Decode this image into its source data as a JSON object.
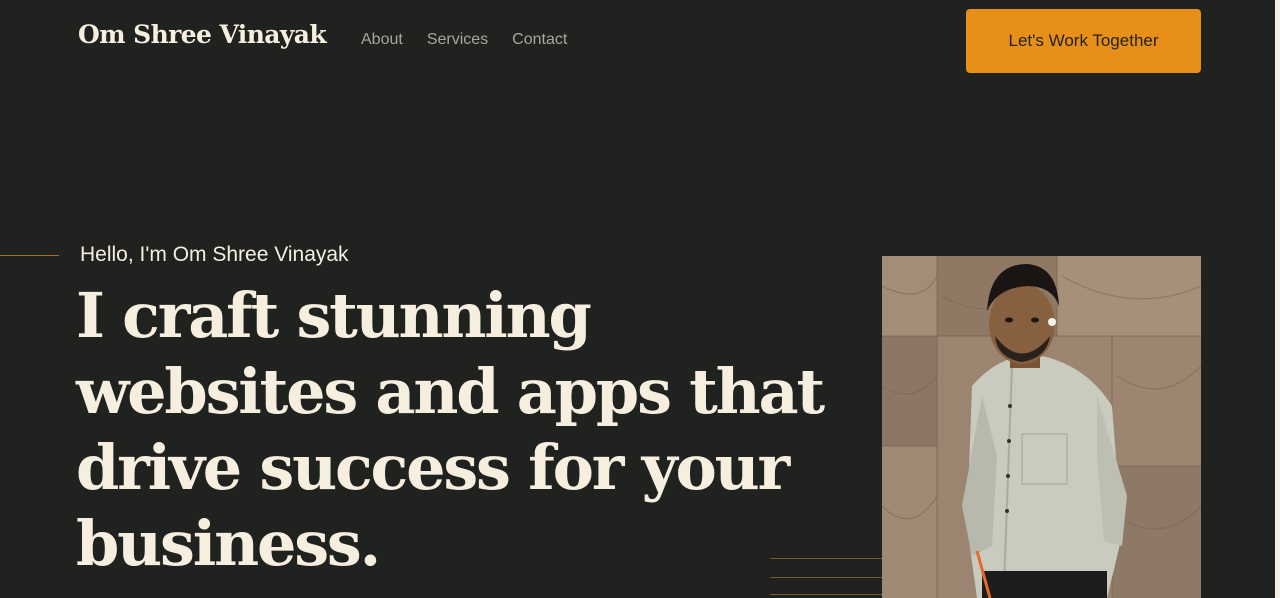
{
  "header": {
    "brand": "Om Shree Vinayak",
    "nav": [
      "About",
      "Services",
      "Contact"
    ],
    "cta_label": "Let's Work Together"
  },
  "hero": {
    "greeting": "Hello, I'm Om Shree Vinayak",
    "headline_lines": [
      "I craft stunning",
      "websites and apps that",
      "drive success for your",
      "business."
    ]
  },
  "colors": {
    "background": "#1f221f",
    "accent": "#e88f19",
    "text": "#f6eedf",
    "nav_text": "#a6a89b"
  }
}
